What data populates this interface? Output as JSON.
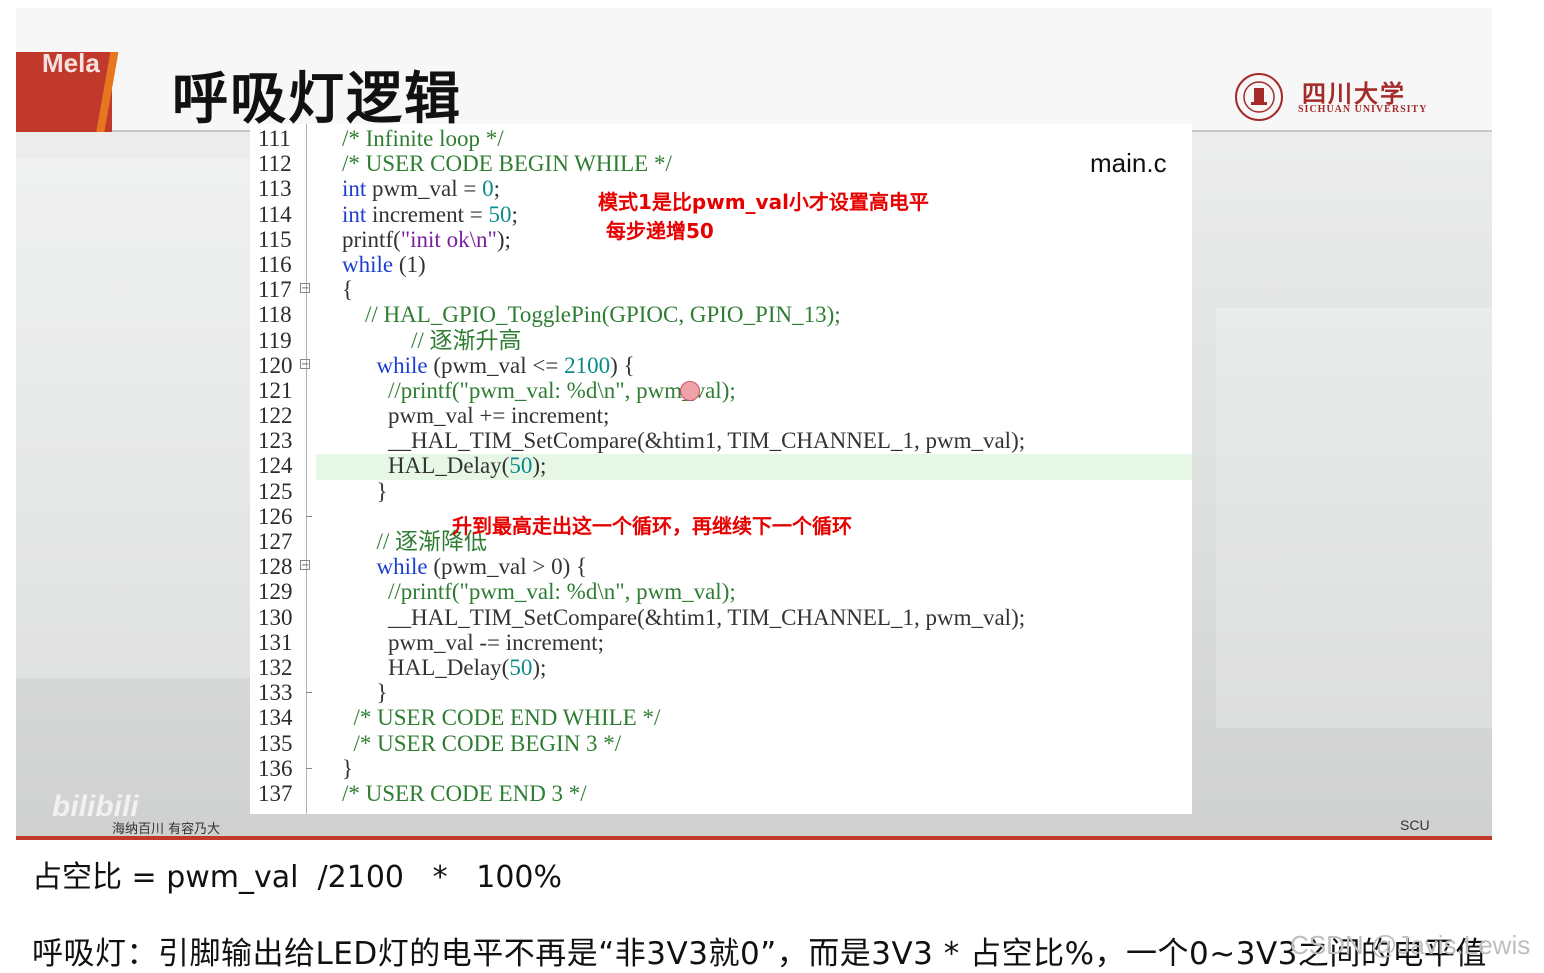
{
  "slide": {
    "watermark_top": "Mela",
    "title": "呼吸灯逻辑",
    "university": {
      "name_cn": "四川大学",
      "name_en": "SICHUAN UNIVERSITY"
    },
    "file_label": "main.c",
    "footer_left": "海纳百川  有容乃大",
    "footer_right": "SCU",
    "bili_watermark": "bilibili"
  },
  "code": {
    "highlight_line": "124",
    "lines": [
      {
        "no": "111",
        "text": "/* Infinite loop */"
      },
      {
        "no": "112",
        "text": "/* USER CODE BEGIN WHILE */"
      },
      {
        "no": "113",
        "kw": "int",
        "rest": " pwm_val = ",
        "num": "0",
        "tail": ";"
      },
      {
        "no": "114",
        "kw": "int",
        "rest": " increment = ",
        "num": "50",
        "tail": ";"
      },
      {
        "no": "115",
        "pre": "printf(",
        "str": "\"init ok\\n\"",
        "tail": ");"
      },
      {
        "no": "116",
        "kw": "while",
        "rest": " (1)"
      },
      {
        "no": "117",
        "text": "{"
      },
      {
        "no": "118",
        "text": "    // HAL_GPIO_TogglePin(GPIOC, GPIO_PIN_13);"
      },
      {
        "no": "119",
        "text": "            // 逐渐升高"
      },
      {
        "no": "120",
        "kw": "while",
        "rest": " (pwm_val <= ",
        "num": "2100",
        "tail": ") {"
      },
      {
        "no": "121",
        "text": "        //printf(\"pwm_val: %d\\n\", pwm_val);"
      },
      {
        "no": "122",
        "text": "        pwm_val += increment;"
      },
      {
        "no": "123",
        "text": "        __HAL_TIM_SetCompare(&htim1, TIM_CHANNEL_1, pwm_val);"
      },
      {
        "no": "124",
        "pre": "        HAL_Delay(",
        "num": "50",
        "tail": ");"
      },
      {
        "no": "125",
        "text": "      }"
      },
      {
        "no": "126",
        "text": ""
      },
      {
        "no": "127",
        "text": "      // 逐渐降低"
      },
      {
        "no": "128",
        "kw": "while",
        "rest": " (pwm_val > 0) {"
      },
      {
        "no": "129",
        "text": "        //printf(\"pwm_val: %d\\n\", pwm_val);"
      },
      {
        "no": "130",
        "text": "        __HAL_TIM_SetCompare(&htim1, TIM_CHANNEL_1, pwm_val);"
      },
      {
        "no": "131",
        "text": "        pwm_val -= increment;"
      },
      {
        "no": "132",
        "pre": "        HAL_Delay(",
        "num": "50",
        "tail": ");"
      },
      {
        "no": "133",
        "text": "      }"
      },
      {
        "no": "134",
        "text": "  /* USER CODE END WHILE */"
      },
      {
        "no": "135",
        "text": "  /* USER CODE BEGIN 3 */"
      },
      {
        "no": "136",
        "text": "}"
      },
      {
        "no": "137",
        "text": "/* USER CODE END 3 */"
      }
    ]
  },
  "notes": {
    "mode": "模式1是比pwm_val小才设置高电平",
    "step": "每步递增50",
    "loop": "升到最高走出这一个循环，再继续下一个循环"
  },
  "below": {
    "formula": "占空比 = pwm_val  /2100   *   100%",
    "explanation": "呼吸灯：引脚输出给LED灯的电平不再是“非3V3就0”，而是3V3 * 占空比%，一个0~3V3之间的电平值",
    "csdn_watermark": "CSDN @Javis.Lewis"
  }
}
